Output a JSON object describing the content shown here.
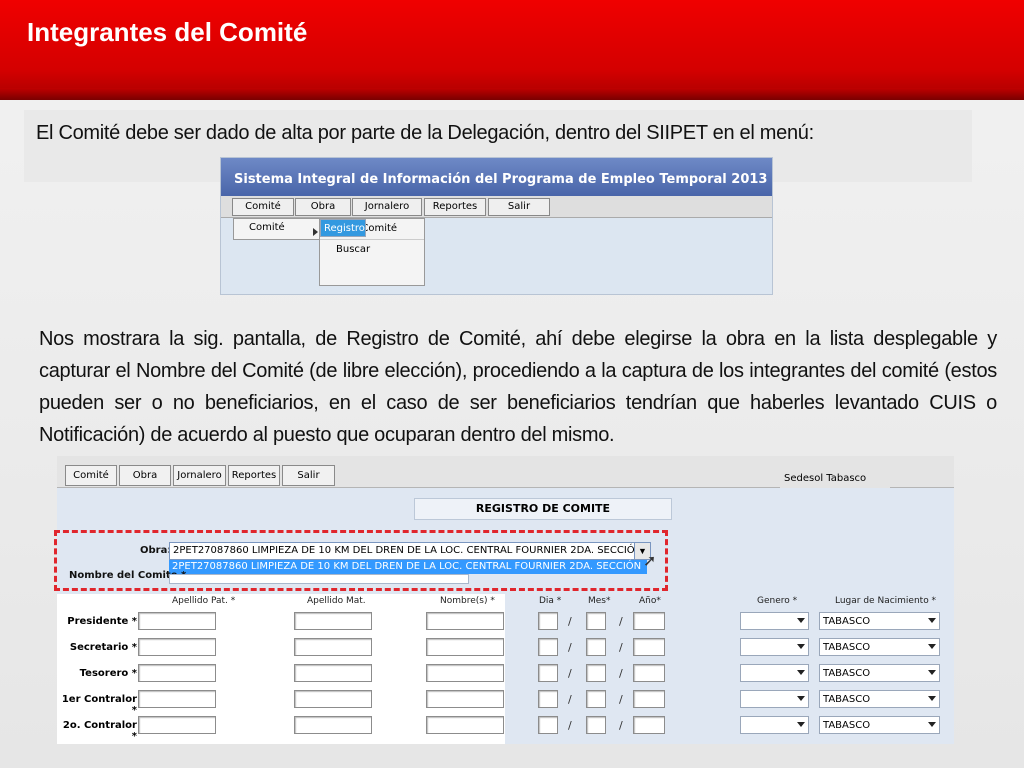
{
  "slide": {
    "title": "Integrantes del Comité",
    "intro": "El Comité debe ser dado de alta por parte de la Delegación, dentro del SIIPET en el menú:",
    "description": "Nos mostrara la sig. pantalla, de Registro de Comité, ahí debe elegirse la obra en la lista desplegable y capturar el Nombre del Comité (de libre elección), procediendo a la captura de los integrantes del comité (estos pueden ser o no beneficiarios, en el caso de ser beneficiarios tendrían que haberles levantado CUIS o Notificación) de acuerdo al puesto que ocuparan dentro del mismo."
  },
  "menu_shot": {
    "header": "Sistema Integral de Información del Programa de Empleo Temporal 2013",
    "menubar": [
      "Comité",
      "Obra",
      "Jornalero",
      "Reportes",
      "Salir"
    ],
    "side_item": "Comité",
    "submenu": [
      "Registro",
      "Acta Comité",
      "Buscar"
    ]
  },
  "form": {
    "menubar": [
      "Comité",
      "Obra",
      "Jornalero",
      "Reportes",
      "Salir"
    ],
    "office": "Sedesol Tabasco",
    "title": "REGISTRO DE COMITE",
    "obra_label": "Obra:",
    "obra_value": "2PET27087860 LIMPIEZA DE 10 KM DEL DREN DE LA LOC. CENTRAL FOURNIER 2DA. SECCIÓN",
    "obra_option": "2PET27087860 LIMPIEZA DE 10 KM DEL DREN DE LA LOC. CENTRAL FOURNIER 2DA. SECCIÓN",
    "nombre_label": "Nombre del Comite *",
    "columns": {
      "apellido_pat": "Apellido Pat. *",
      "apellido_mat": "Apellido Mat.",
      "nombres": "Nombre(s) *",
      "dia": "Dia *",
      "mes": "Mes*",
      "anio": "Año*",
      "genero": "Genero *",
      "lugar": "Lugar de Nacimiento *"
    },
    "rows": [
      "Presidente *",
      "Secretario *",
      "Tesorero *",
      "1er Contralor *",
      "2o. Contralor *"
    ],
    "lugar_default": "TABASCO"
  }
}
